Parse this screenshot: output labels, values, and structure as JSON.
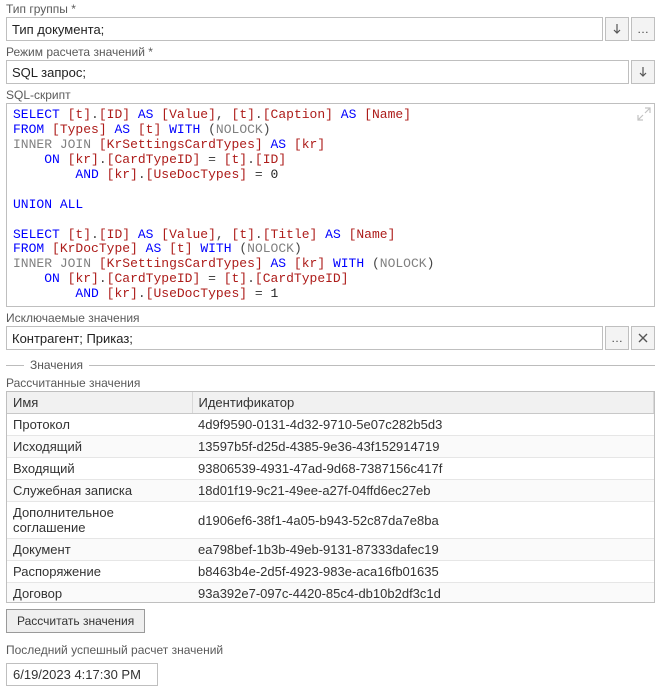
{
  "group_type": {
    "label": "Тип группы  *",
    "value": "Тип документа;"
  },
  "calc_mode": {
    "label": "Режим расчета значений  *",
    "value": "SQL запрос;"
  },
  "sql_script": {
    "label": "SQL-скрипт"
  },
  "excluded": {
    "label": "Исключаемые значения",
    "value": "Контрагент; Приказ;"
  },
  "values_section": {
    "title": "Значения",
    "subtitle": "Рассчитанные значения",
    "columns": {
      "name": "Имя",
      "id": "Идентификатор"
    },
    "rows": [
      {
        "name": "Протокол",
        "id": "4d9f9590-0131-4d32-9710-5e07c282b5d3"
      },
      {
        "name": "Исходящий",
        "id": "13597b5f-d25d-4385-9e36-43f152914719"
      },
      {
        "name": "Входящий",
        "id": "93806539-4931-47ad-9d68-7387156c417f"
      },
      {
        "name": "Служебная записка",
        "id": "18d01f19-9c21-49ee-a27f-04ffd6ec27eb"
      },
      {
        "name": "Дополнительное соглашение",
        "id": "d1906ef6-38f1-4a05-b943-52c87da7e8ba"
      },
      {
        "name": "Документ",
        "id": "ea798bef-1b3b-49eb-9131-87333dafec19"
      },
      {
        "name": "Распоряжение",
        "id": "b8463b4e-2d5f-4923-983e-aca16fb01635"
      },
      {
        "name": "Договор",
        "id": "93a392e7-097c-4420-85c4-db10b2df3c1d"
      }
    ],
    "button": "Рассчитать значения"
  },
  "last_calc": {
    "label": "Последний успешный расчет значений",
    "value": "6/19/2023  4:17:30 PM"
  }
}
